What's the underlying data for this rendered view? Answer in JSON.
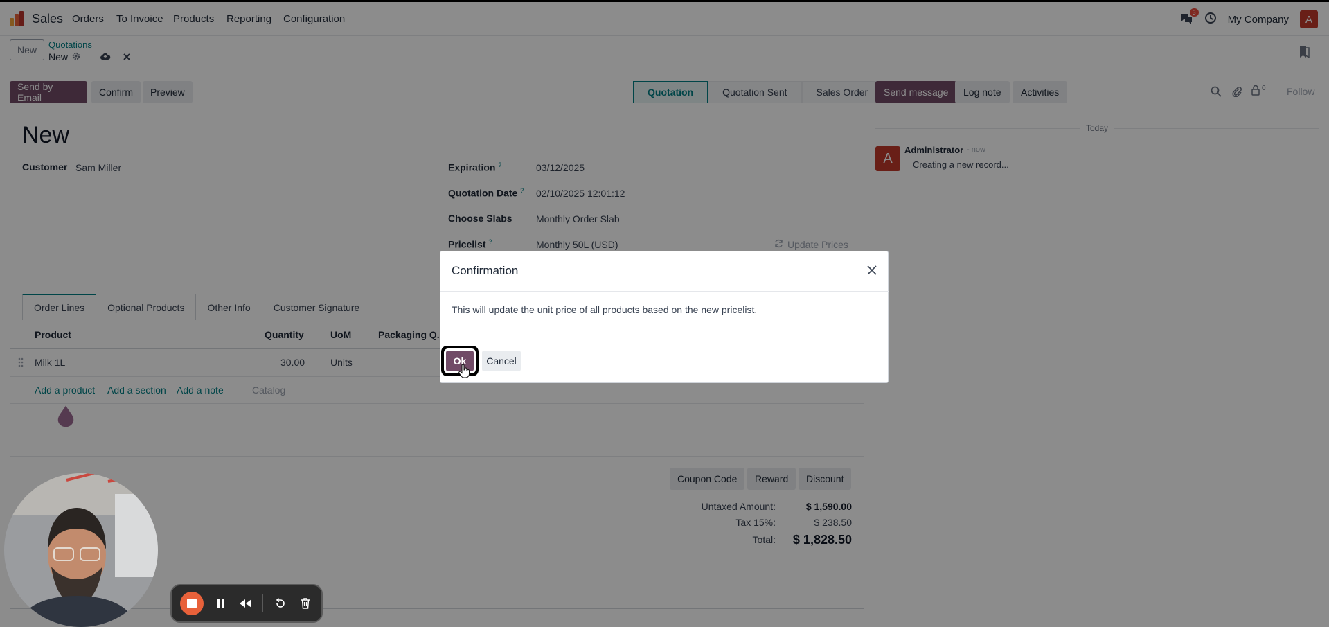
{
  "navbar": {
    "app_name": "Sales",
    "menu": [
      "Orders",
      "To Invoice",
      "Products",
      "Reporting",
      "Configuration"
    ],
    "messages_count": "3",
    "company": "My Company",
    "avatar_letter": "A"
  },
  "control_panel": {
    "new_label": "New",
    "breadcrumb_parent": "Quotations",
    "breadcrumb_current": "New"
  },
  "actions": {
    "send_by_email": "Send by Email",
    "confirm": "Confirm",
    "preview": "Preview"
  },
  "status_stages": [
    "Quotation",
    "Quotation Sent",
    "Sales Order"
  ],
  "status_active": "Quotation",
  "form": {
    "title": "New",
    "customer_label": "Customer",
    "customer_value": "Sam Miller",
    "expiration_label": "Expiration",
    "expiration_value": "03/12/2025",
    "quotation_date_label": "Quotation Date",
    "quotation_date_value": "02/10/2025 12:01:12",
    "choose_slabs_label": "Choose Slabs",
    "choose_slabs_value": "Monthly Order Slab",
    "pricelist_label": "Pricelist",
    "pricelist_value": "Monthly 50L (USD)",
    "update_prices": "Update Prices",
    "help_mark": "?"
  },
  "tabs": [
    "Order Lines",
    "Optional Products",
    "Other Info",
    "Customer Signature"
  ],
  "order_lines": {
    "columns": [
      "Product",
      "Quantity",
      "UoM",
      "Packaging Q..."
    ],
    "rows": [
      {
        "product": "Milk 1L",
        "quantity": "30.00",
        "uom": "Units"
      }
    ],
    "add_product": "Add a product",
    "add_section": "Add a section",
    "add_note": "Add a note",
    "catalog": "Catalog"
  },
  "promo_buttons": [
    "Coupon Code",
    "Reward",
    "Discount"
  ],
  "totals": {
    "untaxed_label": "Untaxed Amount:",
    "untaxed_value": "$ 1,590.00",
    "tax_label": "Tax 15%:",
    "tax_value": "$ 238.50",
    "total_label": "Total:",
    "total_value": "$ 1,828.50"
  },
  "chatter": {
    "send_message": "Send message",
    "log_note": "Log note",
    "activities": "Activities",
    "followers_count": "0",
    "follow": "Follow",
    "day_separator": "Today",
    "author": "Administrator",
    "time": "- now",
    "message": "Creating a new record..."
  },
  "dialog": {
    "title": "Confirmation",
    "body": "This will update the unit price of all products based on the new pricelist.",
    "ok": "Ok",
    "cancel": "Cancel"
  },
  "colors": {
    "primary": "#714b67",
    "link": "#017e84",
    "avatar": "#c0392b",
    "record_button": "#e8613a"
  }
}
